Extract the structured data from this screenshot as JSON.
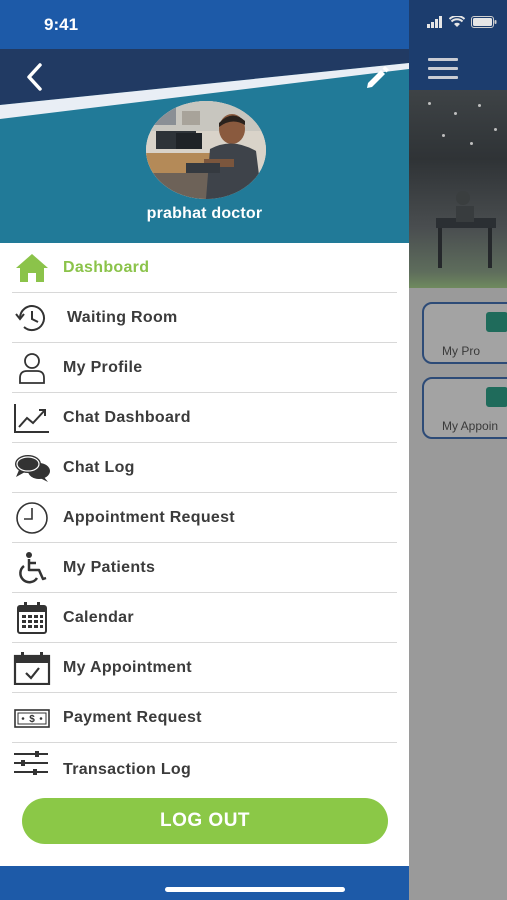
{
  "status_bar": {
    "time": "9:41"
  },
  "profile": {
    "name": "prabhat doctor"
  },
  "menu": {
    "items": [
      {
        "label": "Dashboard",
        "icon": "home-icon",
        "active": true
      },
      {
        "label": "Waiting Room",
        "icon": "history-icon",
        "active": false
      },
      {
        "label": "My Profile",
        "icon": "user-icon",
        "active": false
      },
      {
        "label": "Chat Dashboard",
        "icon": "trend-chart-icon",
        "active": false
      },
      {
        "label": "Chat Log",
        "icon": "chat-bubbles-icon",
        "active": false
      },
      {
        "label": "Appointment Request",
        "icon": "clock-icon",
        "active": false
      },
      {
        "label": "My Patients",
        "icon": "wheelchair-icon",
        "active": false
      },
      {
        "label": "Calendar",
        "icon": "calendar-icon",
        "active": false
      },
      {
        "label": "My Appointment",
        "icon": "calendar-check-icon",
        "active": false
      },
      {
        "label": "Payment Request",
        "icon": "money-bill-icon",
        "active": false
      },
      {
        "label": "Transaction Log",
        "icon": "sliders-icon",
        "active": false
      }
    ]
  },
  "logout": {
    "label": "LOG OUT"
  },
  "background_app": {
    "cards": [
      {
        "label": "My Pro"
      },
      {
        "label": "My Appoin"
      }
    ]
  },
  "colors": {
    "status_bar": "#1d5aa8",
    "header": "#217a98",
    "active": "#8bc34a",
    "logout": "#8bc847"
  }
}
